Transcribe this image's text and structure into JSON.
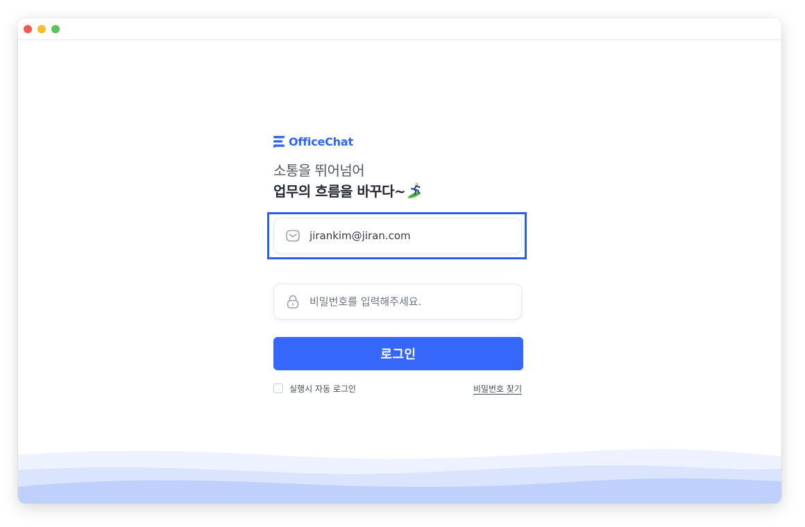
{
  "window": {
    "controls": [
      "close",
      "minimize",
      "maximize"
    ]
  },
  "brand": {
    "name": "OfficeChat",
    "color": "#2f64f6"
  },
  "headline": {
    "line1": "소통을 뛰어넘어",
    "line2": "업무의 흐름을 바꾸다~"
  },
  "form": {
    "email": {
      "value": "jirankim@jiran.com",
      "icon": "envelope-icon"
    },
    "password": {
      "placeholder": "비밀번호를 입력해주세요.",
      "icon": "lock-icon"
    },
    "login_label": "로그인",
    "auto_login_label": "실행시 자동 로그인",
    "find_password_label": "비밀번호 찾기"
  },
  "colors": {
    "primary": "#3667fb",
    "focus_ring": "#2a5ee8",
    "wave_light": "#eef2fe",
    "wave_mid": "#dbe4fd",
    "wave_dark": "#bfd0fc"
  }
}
